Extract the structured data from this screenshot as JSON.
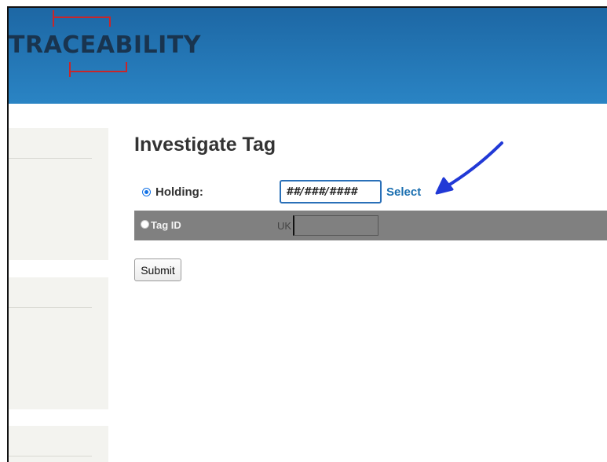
{
  "header": {
    "logo_text": "TRACEABILITY"
  },
  "main": {
    "title": "Investigate Tag",
    "holding": {
      "label": "Holding:",
      "value": "##/###/####",
      "select_link": "Select",
      "selected": true
    },
    "tag_id": {
      "label": "Tag ID",
      "prefix": "UK",
      "value": "",
      "selected": false
    },
    "submit_label": "Submit"
  },
  "colors": {
    "header_top": "#1d67a4",
    "header_bottom": "#2a84c4",
    "logo_text": "#19344f",
    "logo_bracket": "#c8262a",
    "sidebar_panel": "#f3f3ef",
    "tag_row_background": "#808080",
    "link": "#1b6fb0",
    "annotation_arrow": "#2139d6"
  }
}
